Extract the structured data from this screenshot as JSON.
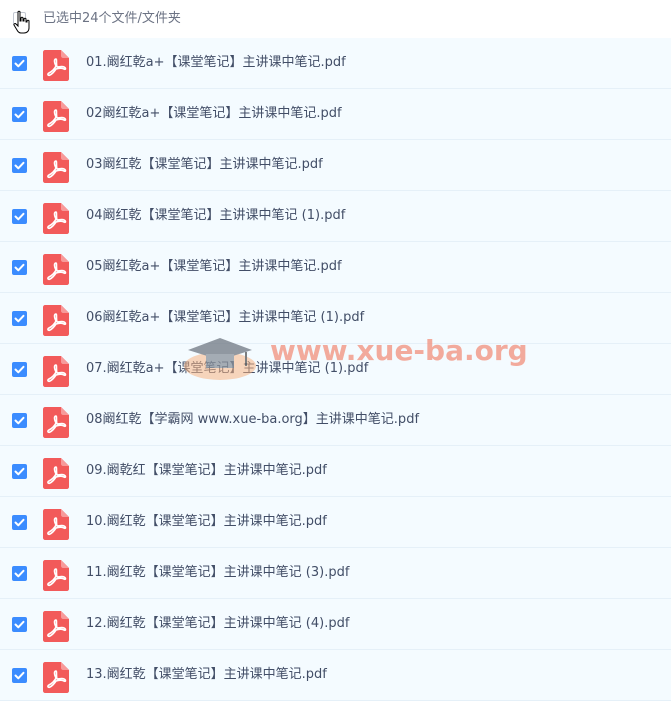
{
  "header": {
    "selection_text": "已选中24个文件/文件夹"
  },
  "files": [
    {
      "name": "01.阚红乾a+【课堂笔记】主讲课中笔记.pdf"
    },
    {
      "name": "02阚红乾a+【课堂笔记】主讲课中笔记.pdf"
    },
    {
      "name": "03阚红乾【课堂笔记】主讲课中笔记.pdf"
    },
    {
      "name": "04阚红乾【课堂笔记】主讲课中笔记 (1).pdf"
    },
    {
      "name": "05阚红乾a+【课堂笔记】主讲课中笔记.pdf"
    },
    {
      "name": "06阚红乾a+【课堂笔记】主讲课中笔记 (1).pdf"
    },
    {
      "name": "07.阚红乾a+【课堂笔记】主讲课中笔记 (1).pdf"
    },
    {
      "name": "08阚红乾【学霸网 www.xue-ba.org】主讲课中笔记.pdf"
    },
    {
      "name": "09.阚乾红【课堂笔记】主讲课中笔记.pdf"
    },
    {
      "name": "10.阚红乾【课堂笔记】主讲课中笔记.pdf"
    },
    {
      "name": "11.阚红乾【课堂笔记】主讲课中笔记 (3).pdf"
    },
    {
      "name": "12.阚红乾【课堂笔记】主讲课中笔记 (4).pdf"
    },
    {
      "name": "13.阚红乾【课堂笔记】主讲课中笔记.pdf"
    }
  ],
  "watermark": {
    "text": "www.xue-ba.org"
  },
  "icons": {
    "file_icon": "pdf-file-icon",
    "checkbox": "check-icon",
    "cursor": "hand-cursor-icon"
  },
  "colors": {
    "checkbox": "#3b8cff",
    "pdf_icon": "#f25a5a",
    "row_background": "#f4fbff",
    "watermark": "#f28f7b"
  }
}
